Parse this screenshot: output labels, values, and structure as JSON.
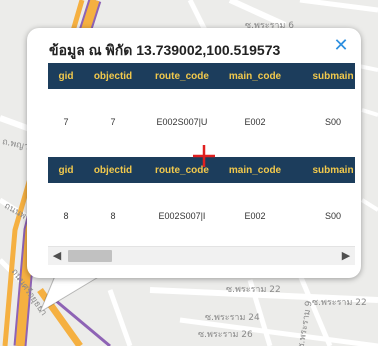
{
  "popup": {
    "title": "ข้อมูล ณ พิกัด 13.739002,100.519573",
    "close_glyph": "✕",
    "records": [
      {
        "headers": [
          "gid",
          "objectid",
          "route_code",
          "main_code",
          "submain"
        ],
        "values": [
          "7",
          "7",
          "E002S007|U",
          "E002",
          "S00"
        ]
      },
      {
        "headers": [
          "gid",
          "objectid",
          "route_code",
          "main_code",
          "submain"
        ],
        "values": [
          "8",
          "8",
          "E002S007|I",
          "E002",
          "S00"
        ]
      }
    ],
    "scroll_left_glyph": "◀",
    "scroll_right_glyph": "▶"
  },
  "map_labels": {
    "top_street": "ซ.พระราม 6",
    "left_road": "ถ.พญาไท",
    "left_road_2": "ถนนพระราม",
    "bottom_left": "ถนนศรีอยุธยา",
    "street_22a": "ซ.พระราม 22",
    "street_22b": "ซ.พระราม 22",
    "street_24": "ซ.พระราม 24",
    "street_26": "ซ.พระราม 26",
    "street_9": "ซ.พระราม 9"
  },
  "colors": {
    "header_bg": "#1c3d5c",
    "header_text": "#f2c94c",
    "close_icon": "#2c8fe0",
    "crosshair": "#e02020",
    "highway": "#f5b041"
  }
}
